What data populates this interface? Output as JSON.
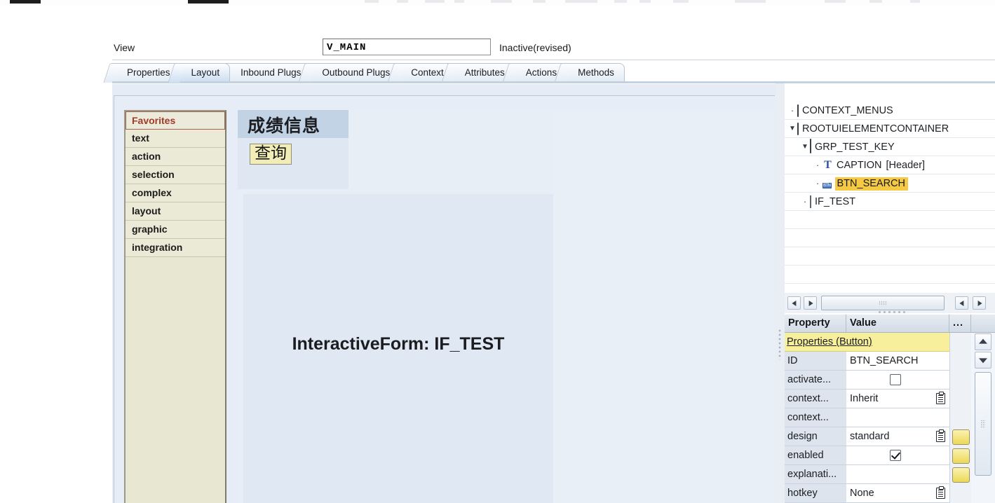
{
  "header": {
    "view_label": "View",
    "view_name": "V_MAIN",
    "status": "Inactive(revised)"
  },
  "tabs": [
    {
      "label": "Properties",
      "active": false
    },
    {
      "label": "Layout",
      "active": true
    },
    {
      "label": "Inbound Plugs",
      "active": false
    },
    {
      "label": "Outbound Plugs",
      "active": false
    },
    {
      "label": "Context",
      "active": false
    },
    {
      "label": "Attributes",
      "active": false
    },
    {
      "label": "Actions",
      "active": false
    },
    {
      "label": "Methods",
      "active": false
    }
  ],
  "palette": {
    "items": [
      {
        "label": "Favorites",
        "selected": true
      },
      {
        "label": "text",
        "selected": false
      },
      {
        "label": "action",
        "selected": false
      },
      {
        "label": "selection",
        "selected": false
      },
      {
        "label": "complex",
        "selected": false
      },
      {
        "label": "layout",
        "selected": false
      },
      {
        "label": "graphic",
        "selected": false
      },
      {
        "label": "integration",
        "selected": false
      }
    ]
  },
  "canvas": {
    "group_caption": "成绩信息",
    "button_label": "查询",
    "interactive_form_label": "InteractiveForm: IF_TEST"
  },
  "tree": {
    "nodes": [
      {
        "indent": 0,
        "twisty": "dot",
        "icon": "checkbox-icon",
        "label": "CONTEXT_MENUS",
        "highlight": false
      },
      {
        "indent": 0,
        "twisty": "expanded",
        "icon": "checkbox-icon",
        "label": "ROOTUIELEMENTCONTAINER",
        "highlight": false
      },
      {
        "indent": 1,
        "twisty": "expanded",
        "icon": "group-icon",
        "label": "GRP_TEST_KEY",
        "highlight": false
      },
      {
        "indent": 2,
        "twisty": "dot",
        "icon": "text-icon",
        "label": "CAPTION",
        "suffix": "[Header]",
        "highlight": false
      },
      {
        "indent": 2,
        "twisty": "dot",
        "icon": "button-icon",
        "label": "BTN_SEARCH",
        "highlight": true
      },
      {
        "indent": 1,
        "twisty": "dot",
        "icon": "interactive-form-icon",
        "label": "IF_TEST",
        "highlight": false
      }
    ]
  },
  "property_grid": {
    "columns": [
      "Property",
      "Value",
      "..."
    ],
    "rows": [
      {
        "type": "section",
        "name": "Properties (Button)"
      },
      {
        "type": "text",
        "name": "ID",
        "value": "BTN_SEARCH",
        "lookup": false,
        "ybtn": false
      },
      {
        "type": "checkbox",
        "name": "activate...",
        "checked": false,
        "ybtn": false
      },
      {
        "type": "text",
        "name": "context...",
        "value": "Inherit",
        "lookup": true,
        "ybtn": false
      },
      {
        "type": "text",
        "name": "context...",
        "value": "",
        "lookup": false,
        "ybtn": false
      },
      {
        "type": "text",
        "name": "design",
        "value": "standard",
        "lookup": true,
        "ybtn": true
      },
      {
        "type": "checkbox",
        "name": "enabled",
        "checked": true,
        "ybtn": true
      },
      {
        "type": "text",
        "name": "explanati...",
        "value": "",
        "lookup": false,
        "ybtn": true
      },
      {
        "type": "text",
        "name": "hotkey",
        "value": "None",
        "lookup": true,
        "ybtn": false
      }
    ]
  },
  "colors": {
    "highlight": "#f6c944",
    "section": "#f7ef9c",
    "palette_bg": "#eaead6",
    "selected_text": "#a33a28",
    "canvas_bg": "#e8eef6"
  }
}
